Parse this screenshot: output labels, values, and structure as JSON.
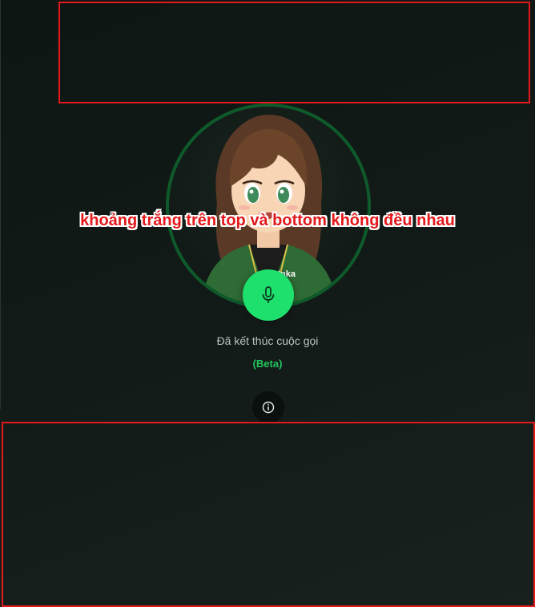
{
  "call": {
    "status_text": "Đã kết thúc cuộc gọi",
    "beta_label": "(Beta)",
    "badge_text": "Inka"
  },
  "annotation": {
    "text": "khoảng trắng trên top và bottom không đều nhau",
    "color": "#e3191b"
  },
  "colors": {
    "mic_button": "#1ee06d",
    "ring": "#0e5a2b",
    "beta": "#22c55e",
    "background": "#121a17"
  },
  "icons": {
    "mic": "microphone-icon",
    "info": "info-icon"
  }
}
